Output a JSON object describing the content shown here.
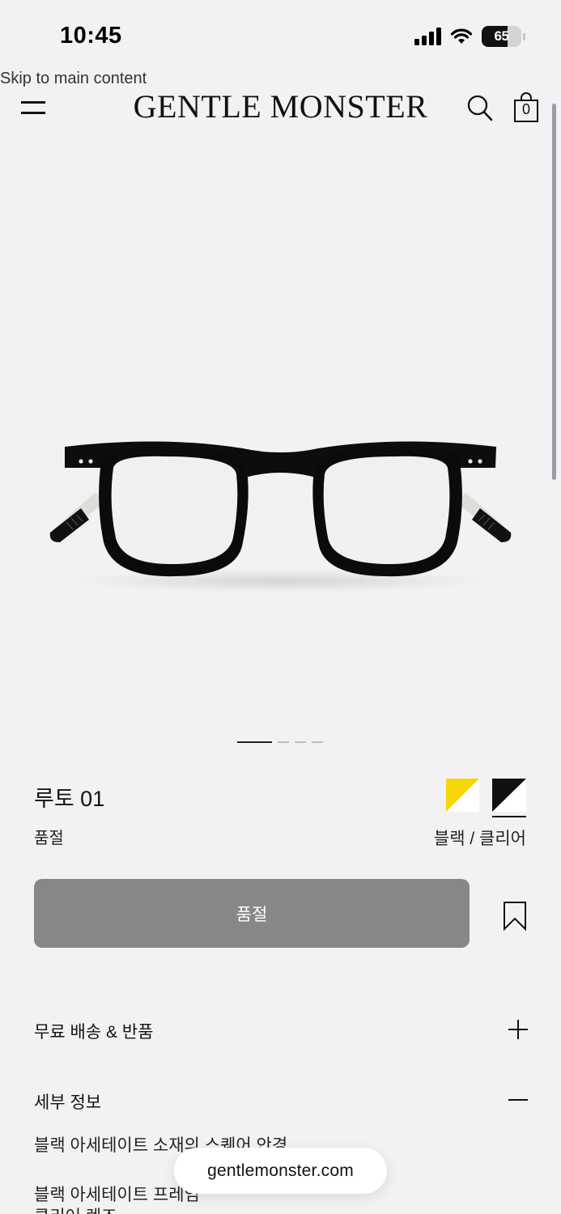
{
  "status_bar": {
    "time": "10:45",
    "battery": "65",
    "battery_level_percent": 65,
    "icons": [
      "cellular-signal-icon",
      "wifi-icon",
      "battery-icon"
    ]
  },
  "skip_link": "Skip to main content",
  "header": {
    "brand": "GENTLE MONSTER",
    "cart_count": "0",
    "icons": [
      "menu-icon",
      "search-icon",
      "shopping-bag-icon"
    ]
  },
  "carousel": {
    "slide_count": 4,
    "active_index": 0
  },
  "product": {
    "name": "루토 01",
    "stock_status": "품절",
    "color_name": "블랙 / 클리어",
    "swatches": [
      {
        "name": "yellow",
        "colors": [
          "#f7d606",
          "#ffffff"
        ]
      },
      {
        "name": "black-clear",
        "colors": [
          "#111111",
          "#ffffff"
        ],
        "selected": true
      }
    ]
  },
  "actions": {
    "soldout_button": "품절",
    "bookmark_icon": "bookmark-icon"
  },
  "accordions": {
    "shipping": {
      "label": "무료 배송 & 반품",
      "icon": "plus-icon"
    },
    "details": {
      "label": "세부 정보",
      "icon": "minus-icon",
      "lines": [
        "블랙 아세테이트 소재의 스퀘어 안경",
        "블랙 아세테이트 프레임",
        "클리어 렌즈"
      ]
    }
  },
  "browser": {
    "url": "gentlemonster.com"
  },
  "colors": {
    "background": "#f2f2f4",
    "soldout_button": "#878787",
    "text": "#111111"
  }
}
